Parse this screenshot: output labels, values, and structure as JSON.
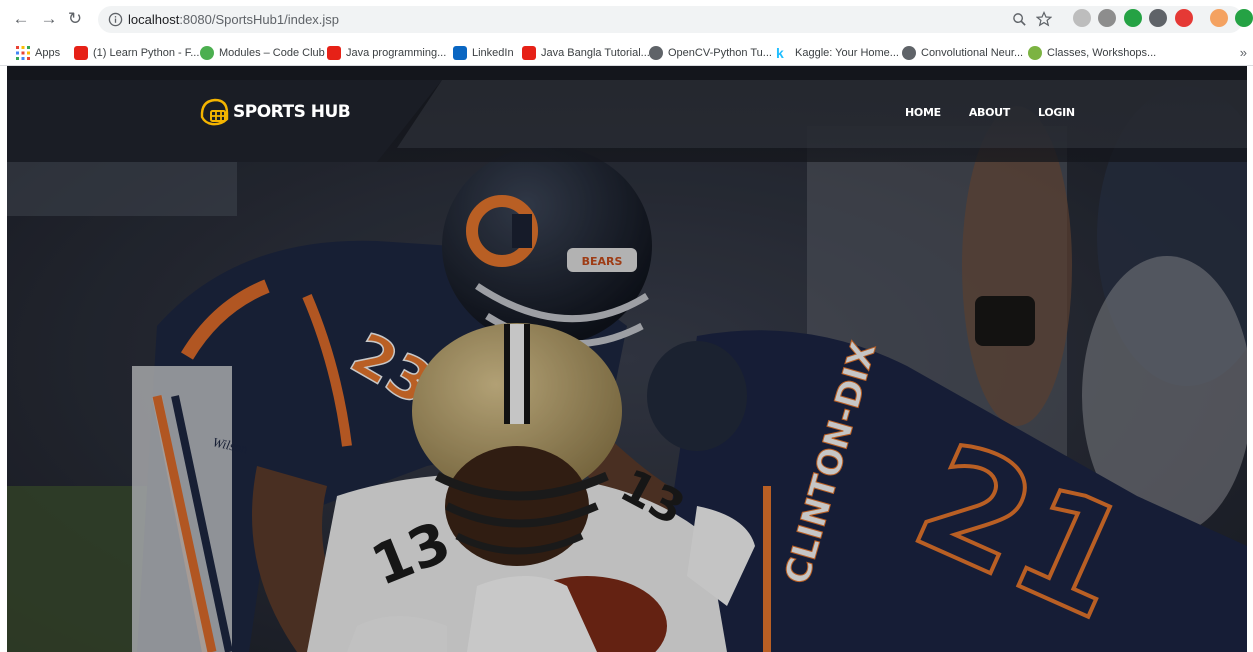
{
  "browser": {
    "url_host": "localhost",
    "url_rest": ":8080/SportsHub1/index.jsp",
    "bookmarks": [
      {
        "label": "Apps",
        "color": "#e8453c"
      },
      {
        "label": "(1) Learn Python - F...",
        "color": "#e62117"
      },
      {
        "label": "Modules – Code Club",
        "color": "#4caf50"
      },
      {
        "label": "Java programming...",
        "color": "#e62117"
      },
      {
        "label": "LinkedIn",
        "color": "#0a66c2"
      },
      {
        "label": "Java Bangla Tutorial...",
        "color": "#e62117"
      },
      {
        "label": "OpenCV-Python Tu...",
        "color": "#5f6368"
      },
      {
        "label": "Kaggle: Your Home...",
        "color": "#20beff"
      },
      {
        "label": "Convolutional Neur...",
        "color": "#5f6368"
      },
      {
        "label": "Classes, Workshops...",
        "color": "#7cb342"
      }
    ],
    "more": "»"
  },
  "site": {
    "brand": "SPORTS HUB",
    "nav": [
      {
        "label": "HOME"
      },
      {
        "label": "ABOUT"
      },
      {
        "label": "LOGIN"
      }
    ]
  },
  "hero": {
    "player_front_number": "13",
    "player_left_number": "23",
    "player_right_number": "21",
    "player_right_name": "CLINTON-DIX",
    "helmet_logo": "C",
    "helmet_text": "BEARS",
    "glove_text": "Wilson"
  }
}
